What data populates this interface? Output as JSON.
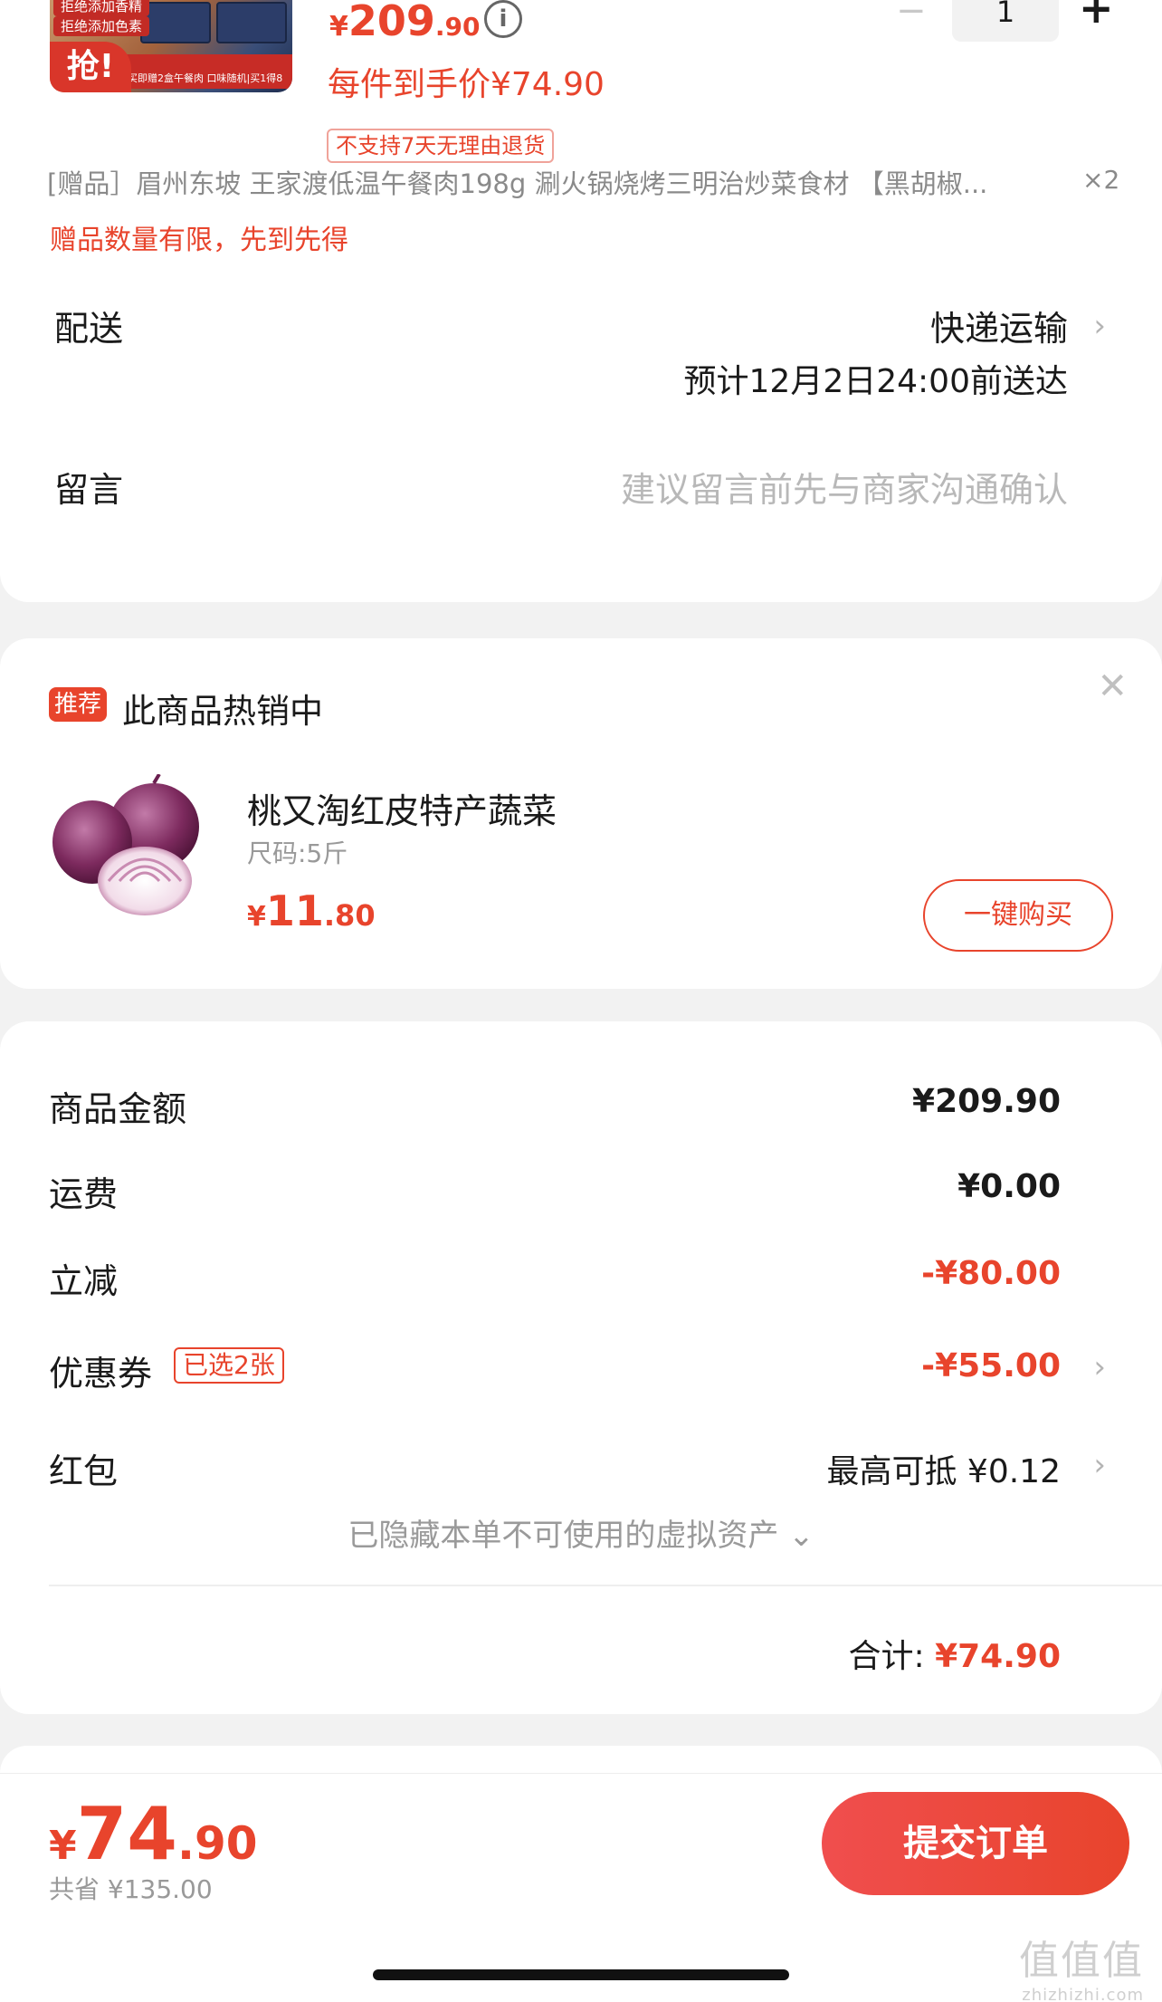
{
  "product": {
    "thumb_tags": [
      "拒绝添加香精",
      "拒绝添加色素"
    ],
    "thumb_grab": "抢!",
    "thumb_strip": "买即赠2盒午餐肉 口味随机|买1得8",
    "price_currency": "¥",
    "price_int": "209",
    "price_dec": ".90",
    "info_icon": "i",
    "unit_price": "每件到手价¥74.90",
    "no_return": "不支持7天无理由退货",
    "quantity": "1",
    "minus": "−",
    "plus": "+"
  },
  "gift": {
    "text": "[赠品］眉州东坡 王家渡低温午餐肉198g 涮火锅烧烤三明治炒菜食材 【黑胡椒...",
    "qty": "×2",
    "limit_note": "赠品数量有限，先到先得"
  },
  "delivery": {
    "label": "配送",
    "method": "快递运输",
    "eta": "预计12月2日24:00前送达"
  },
  "message": {
    "label": "留言",
    "placeholder": "建议留言前先与商家沟通确认"
  },
  "recommend": {
    "badge": "推荐",
    "title": "此商品热销中",
    "close": "✕",
    "item_name": "桃又淘红皮特产蔬菜",
    "item_spec": "尺码:5斤",
    "price_currency": "¥",
    "price_int": "11",
    "price_dec": ".80",
    "buy_label": "一键购买"
  },
  "summary": {
    "rows": [
      {
        "label": "商品金额",
        "value": "¥209.90"
      },
      {
        "label": "运费",
        "value": "¥0.00"
      },
      {
        "label": "立减",
        "value": "-¥80.00"
      },
      {
        "label": "优惠券",
        "tag": "已选2张",
        "value": "-¥55.00"
      },
      {
        "label": "红包",
        "value": "最高可抵 ¥0.12"
      }
    ],
    "hidden_assets": "已隐藏本单不可使用的虚拟资产 ⌄",
    "total_label": "合计:",
    "total_value": "¥74.90"
  },
  "bottom_bar": {
    "price_currency": "¥",
    "price_int": "74",
    "price_dec": ".90",
    "saved": "共省 ¥135.00",
    "submit_label": "提交订单"
  },
  "watermark": {
    "text": "值值值",
    "sub": "zhizhizhi.com"
  },
  "colors": {
    "accent": "#e8442c",
    "background": "#f2f2f2"
  }
}
